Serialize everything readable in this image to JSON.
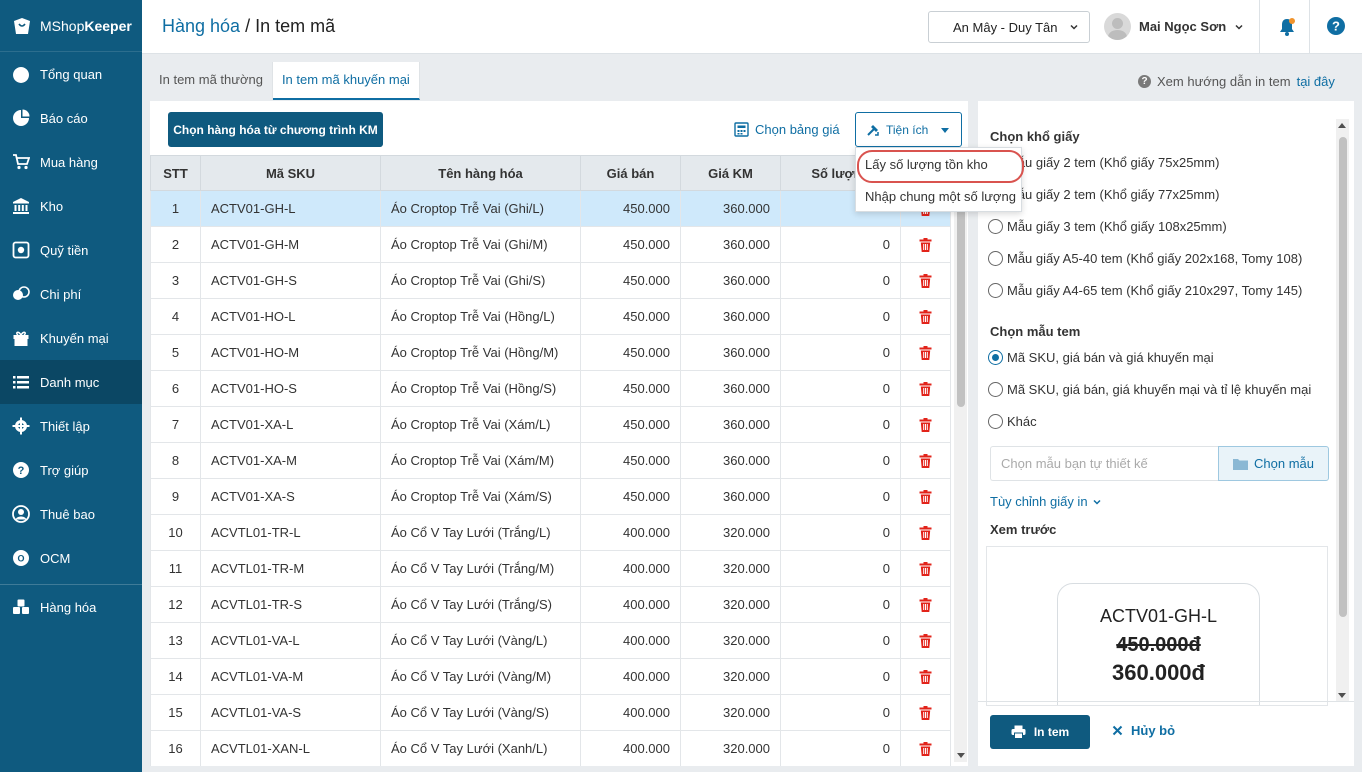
{
  "app": {
    "brand_prefix": "MShop",
    "brand_suffix": "Keeper"
  },
  "sidebar": {
    "items": [
      {
        "label": "Tổng quan",
        "icon": "dashboard-icon"
      },
      {
        "label": "Báo cáo",
        "icon": "pie-chart-icon"
      },
      {
        "label": "Mua hàng",
        "icon": "cart-icon"
      },
      {
        "label": "Kho",
        "icon": "warehouse-icon"
      },
      {
        "label": "Quỹ tiền",
        "icon": "safe-icon"
      },
      {
        "label": "Chi phí",
        "icon": "money-icon"
      },
      {
        "label": "Khuyến mại",
        "icon": "gift-icon"
      },
      {
        "label": "Danh mục",
        "icon": "list-icon"
      },
      {
        "label": "Thiết lập",
        "icon": "gear-icon"
      },
      {
        "label": "Trợ giúp",
        "icon": "help-icon"
      },
      {
        "label": "Thuê bao",
        "icon": "user-icon"
      },
      {
        "label": "OCM",
        "icon": "ocm-icon"
      },
      {
        "label": "Hàng hóa",
        "icon": "boxes-icon"
      }
    ],
    "active": "Danh mục"
  },
  "header": {
    "breadcrumb": "Hàng hóa",
    "separator": " / ",
    "title": "In tem mã",
    "branch": "An Mây - Duy Tân",
    "user_name": "Mai Ngọc Sơn"
  },
  "tabs": [
    {
      "label": "In tem mã thường",
      "active": false
    },
    {
      "label": "In tem mã khuyến mại",
      "active": true
    }
  ],
  "guide": {
    "text": "Xem hướng dẫn in tem",
    "link": "tại đây"
  },
  "toolbar": {
    "choose_label": "Chọn hàng hóa từ chương trình KM",
    "price_table_label": "Chọn bảng giá",
    "utility_label": "Tiện ích"
  },
  "dropdown": {
    "items": [
      "Lấy số lượng tồn kho",
      "Nhập chung một số lượng"
    ]
  },
  "table": {
    "columns": [
      "STT",
      "Mã SKU",
      "Tên hàng hóa",
      "Giá bán",
      "Giá KM",
      "Số lượng",
      ""
    ],
    "rows": [
      {
        "stt": "1",
        "sku": "ACTV01-GH-L",
        "name": "Áo Croptop Trễ Vai (Ghi/L)",
        "price": "450.000",
        "promo": "360.000",
        "qty": ""
      },
      {
        "stt": "2",
        "sku": "ACTV01-GH-M",
        "name": "Áo Croptop Trễ Vai (Ghi/M)",
        "price": "450.000",
        "promo": "360.000",
        "qty": "0"
      },
      {
        "stt": "3",
        "sku": "ACTV01-GH-S",
        "name": "Áo Croptop Trễ Vai (Ghi/S)",
        "price": "450.000",
        "promo": "360.000",
        "qty": "0"
      },
      {
        "stt": "4",
        "sku": "ACTV01-HO-L",
        "name": "Áo Croptop Trễ Vai (Hồng/L)",
        "price": "450.000",
        "promo": "360.000",
        "qty": "0"
      },
      {
        "stt": "5",
        "sku": "ACTV01-HO-M",
        "name": "Áo Croptop Trễ Vai (Hồng/M)",
        "price": "450.000",
        "promo": "360.000",
        "qty": "0"
      },
      {
        "stt": "6",
        "sku": "ACTV01-HO-S",
        "name": "Áo Croptop Trễ Vai (Hồng/S)",
        "price": "450.000",
        "promo": "360.000",
        "qty": "0"
      },
      {
        "stt": "7",
        "sku": "ACTV01-XA-L",
        "name": "Áo Croptop Trễ Vai (Xám/L)",
        "price": "450.000",
        "promo": "360.000",
        "qty": "0"
      },
      {
        "stt": "8",
        "sku": "ACTV01-XA-M",
        "name": "Áo Croptop Trễ Vai (Xám/M)",
        "price": "450.000",
        "promo": "360.000",
        "qty": "0"
      },
      {
        "stt": "9",
        "sku": "ACTV01-XA-S",
        "name": "Áo Croptop Trễ Vai (Xám/S)",
        "price": "450.000",
        "promo": "360.000",
        "qty": "0"
      },
      {
        "stt": "10",
        "sku": "ACVTL01-TR-L",
        "name": "Áo Cổ V Tay Lưới (Trắng/L)",
        "price": "400.000",
        "promo": "320.000",
        "qty": "0"
      },
      {
        "stt": "11",
        "sku": "ACVTL01-TR-M",
        "name": "Áo Cổ V Tay Lưới (Trắng/M)",
        "price": "400.000",
        "promo": "320.000",
        "qty": "0"
      },
      {
        "stt": "12",
        "sku": "ACVTL01-TR-S",
        "name": "Áo Cổ V Tay Lưới (Trắng/S)",
        "price": "400.000",
        "promo": "320.000",
        "qty": "0"
      },
      {
        "stt": "13",
        "sku": "ACVTL01-VA-L",
        "name": "Áo Cổ V Tay Lưới (Vàng/L)",
        "price": "400.000",
        "promo": "320.000",
        "qty": "0"
      },
      {
        "stt": "14",
        "sku": "ACVTL01-VA-M",
        "name": "Áo Cổ V Tay Lưới (Vàng/M)",
        "price": "400.000",
        "promo": "320.000",
        "qty": "0"
      },
      {
        "stt": "15",
        "sku": "ACVTL01-VA-S",
        "name": "Áo Cổ V Tay Lưới (Vàng/S)",
        "price": "400.000",
        "promo": "320.000",
        "qty": "0"
      },
      {
        "stt": "16",
        "sku": "ACVTL01-XAN-L",
        "name": "Áo Cổ V Tay Lưới (Xanh/L)",
        "price": "400.000",
        "promo": "320.000",
        "qty": "0"
      }
    ]
  },
  "right": {
    "paper_title": "Chọn khổ giấy",
    "paper_options": [
      {
        "label": "Mẫu giấy 2 tem (Khổ giấy 75x25mm)",
        "checked": false
      },
      {
        "label": "Mẫu giấy 2 tem (Khổ giấy 77x25mm)",
        "checked": false
      },
      {
        "label": "Mẫu giấy 3 tem (Khổ giấy 108x25mm)",
        "checked": false
      },
      {
        "label": "Mẫu giấy A5-40 tem (Khổ giấy 202x168, Tomy 108)",
        "checked": false
      },
      {
        "label": "Mẫu giấy A4-65 tem (Khổ giấy 210x297, Tomy 145)",
        "checked": false
      }
    ],
    "template_title": "Chọn mẫu tem",
    "template_options": [
      {
        "label": "Mã SKU, giá bán và giá khuyến mại",
        "checked": true
      },
      {
        "label": "Mã SKU, giá bán, giá khuyến mại và tỉ lệ khuyến mại",
        "checked": false
      },
      {
        "label": "Khác",
        "checked": false
      }
    ],
    "template_placeholder": "Chọn mẫu bạn tự thiết kế",
    "template_button": "Chọn mẫu",
    "customize_label": "Tùy chỉnh giấy in",
    "preview_title": "Xem trước",
    "preview": {
      "sku": "ACTV01-GH-L",
      "old_price": "450.000đ",
      "new_price": "360.000đ"
    },
    "print_label": "In tem",
    "cancel_label": "Hủy bỏ"
  },
  "colors": {
    "sidebar": "#0f5a7f",
    "accent": "#0f6ea3",
    "delete": "#e2231a",
    "selected_row": "#cfe9fb"
  }
}
